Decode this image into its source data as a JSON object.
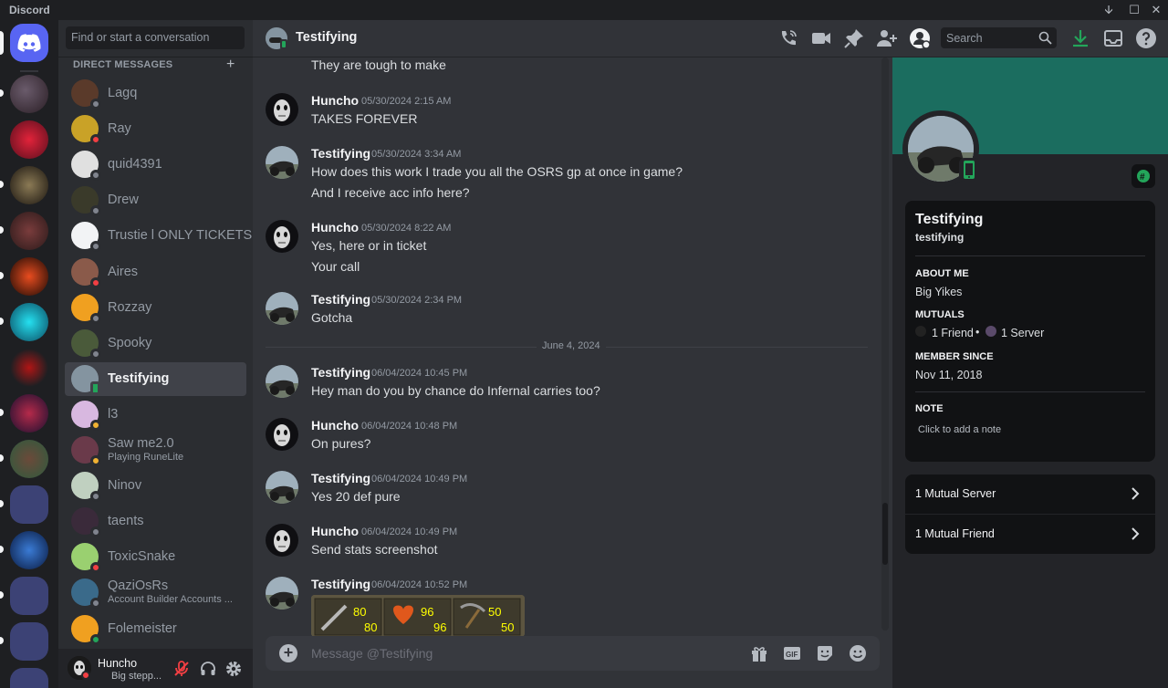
{
  "window": {
    "app_name": "Discord",
    "minimize": "🡫",
    "maximize": "☐",
    "close": "✕"
  },
  "sidebar": {
    "search_placeholder": "Find or start a conversation",
    "section_label": "DIRECT MESSAGES",
    "add": "+",
    "dms": [
      {
        "name": "Lagq",
        "status": "offline"
      },
      {
        "name": "Ray",
        "status": "dnd"
      },
      {
        "name": "quid4391",
        "status": "offline"
      },
      {
        "name": "Drew",
        "status": "offline"
      },
      {
        "name": "Trustie l ONLY TICKETS",
        "status": "offline"
      },
      {
        "name": "Aires",
        "status": "dnd"
      },
      {
        "name": "Rozzay",
        "status": "offline"
      },
      {
        "name": "Spooky",
        "status": "offline"
      },
      {
        "name": "Testifying",
        "status": "mobile",
        "active": true
      },
      {
        "name": "l3",
        "status": "idle"
      },
      {
        "name": "Saw me2.0",
        "sub": "Playing RuneLite",
        "status": "idle"
      },
      {
        "name": "Ninov",
        "status": "offline"
      },
      {
        "name": "taents",
        "status": "offline"
      },
      {
        "name": "ToxicSnake",
        "status": "dnd"
      },
      {
        "name": "QaziOsRs",
        "sub": "Account Builder Accounts ...",
        "status": "offline"
      },
      {
        "name": "Folemeister",
        "status": "online"
      }
    ]
  },
  "user_panel": {
    "name": "Huncho",
    "status": "Big stepp..."
  },
  "header": {
    "title": "Testifying",
    "search_placeholder": "Search"
  },
  "chat": {
    "date_separator": "June 4, 2024",
    "input_placeholder": "Message @Testifying",
    "messages": [
      {
        "author": "",
        "time": "",
        "lines": [
          "They are tough to make"
        ]
      },
      {
        "author": "Huncho",
        "time": "05/30/2024 2:15 AM",
        "lines": [
          "TAKES FOREVER"
        ]
      },
      {
        "author": "Testifying",
        "time": "05/30/2024 3:34 AM",
        "lines": [
          "How does this work I trade you all the OSRS gp at once in game?",
          "And I receive acc info here?"
        ]
      },
      {
        "author": "Huncho",
        "time": "05/30/2024 8:22 AM",
        "lines": [
          "Yes, here or in ticket",
          "Your call"
        ]
      },
      {
        "author": "Testifying",
        "time": "05/30/2024 2:34 PM",
        "lines": [
          "Gotcha"
        ]
      },
      {
        "author": "Testifying",
        "time": "06/04/2024 10:45 PM",
        "lines": [
          "Hey man do you by chance do Infernal carries too?"
        ]
      },
      {
        "author": "Huncho",
        "time": "06/04/2024 10:48 PM",
        "lines": [
          "On pures?"
        ]
      },
      {
        "author": "Testifying",
        "time": "06/04/2024 10:49 PM",
        "lines": [
          "Yes 20 def pure"
        ]
      },
      {
        "author": "Huncho",
        "time": "06/04/2024 10:49 PM",
        "lines": [
          "Send stats screenshot"
        ]
      },
      {
        "author": "Testifying",
        "time": "06/04/2024 10:52 PM",
        "lines": []
      }
    ],
    "attachment_stats": [
      {
        "top": "80",
        "bottom": "80"
      },
      {
        "top": "96",
        "bottom": "96"
      },
      {
        "top": "50",
        "bottom": "50"
      }
    ]
  },
  "profile": {
    "display_name": "Testifying",
    "username": "testifying",
    "about_label": "ABOUT ME",
    "about": "Big Yikes",
    "mutuals_label": "MUTUALS",
    "mutual_friends": "1 Friend",
    "mutual_dot": "•",
    "mutual_servers": "1 Server",
    "member_since_label": "MEMBER SINCE",
    "member_since": "Nov 11, 2018",
    "note_label": "NOTE",
    "note_placeholder": "Click to add a note",
    "mutual_server_link": "1 Mutual Server",
    "mutual_friend_link": "1 Mutual Friend"
  },
  "colors": {
    "brand": "#5865f2",
    "online": "#23a55a",
    "idle": "#f0b232",
    "dnd": "#f23f43",
    "offline": "#80848e",
    "banner": "#1b6d5f",
    "download": "#23a55a"
  }
}
